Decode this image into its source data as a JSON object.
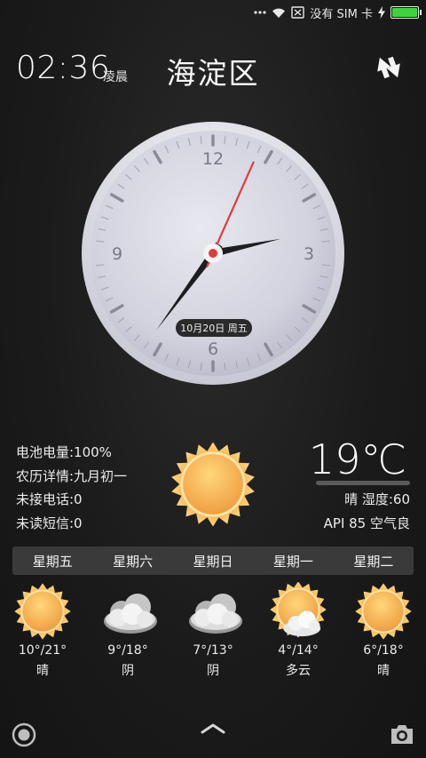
{
  "status_bar": {
    "carrier": "没有 SIM 卡",
    "icons": [
      "dots-icon",
      "wifi-icon",
      "no-sim-icon",
      "charging-icon",
      "battery-icon"
    ],
    "battery_level": 1.0,
    "battery_color": "#3ed33e"
  },
  "header": {
    "time": "02:36",
    "period": "凌晨",
    "district": "海淀区",
    "refresh_icon": "refresh-icon"
  },
  "clock": {
    "numbers": [
      "12",
      "3",
      "6",
      "9"
    ],
    "date": "10月20日 周五",
    "hour": 2,
    "minute": 36,
    "second": 4,
    "second_hand_color": "#e23b3b"
  },
  "device_info": [
    "电池电量:100%",
    "农历详情:九月初一",
    "未接电话:0",
    "未读短信:0"
  ],
  "current_weather": {
    "temperature": "19℃",
    "condition_humidity": "晴 湿度:60",
    "air_quality": "API 85 空气良",
    "icon": "sun-icon"
  },
  "forecast": [
    {
      "day": "星期五",
      "temp": "10°/21°",
      "cond": "晴",
      "icon": "sun"
    },
    {
      "day": "星期六",
      "temp": "9°/18°",
      "cond": "阴",
      "icon": "cloud"
    },
    {
      "day": "星期日",
      "temp": "7°/13°",
      "cond": "阴",
      "icon": "cloud"
    },
    {
      "day": "星期一",
      "temp": "4°/14°",
      "cond": "多云",
      "icon": "sun-cloud"
    },
    {
      "day": "星期二",
      "temp": "6°/18°",
      "cond": "晴",
      "icon": "sun"
    }
  ],
  "bottom_bar": {
    "left_icon": "record-icon",
    "middle_icon": "chevron-up-icon",
    "right_icon": "camera-icon"
  }
}
